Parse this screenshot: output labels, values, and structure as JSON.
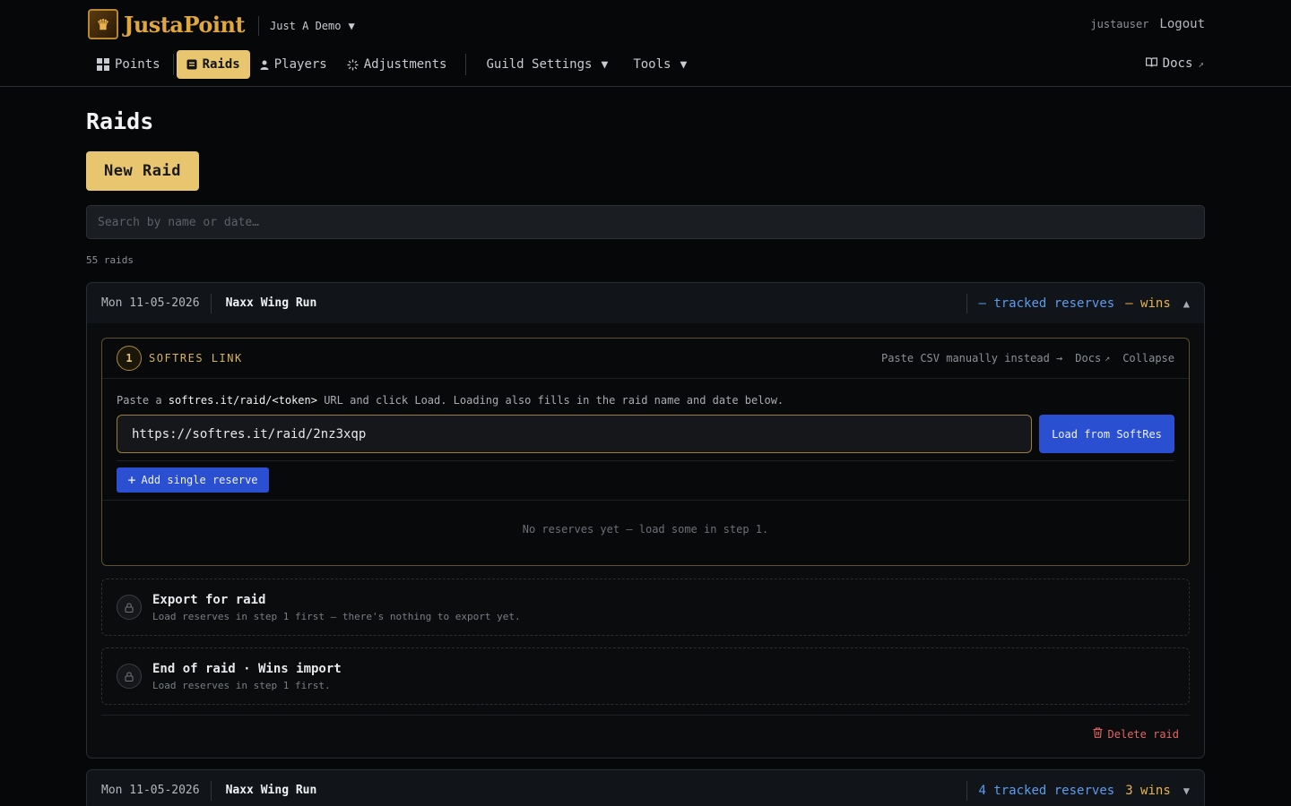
{
  "header": {
    "app_name": "JustaPoint",
    "logo_glyph": "♛",
    "guild": "Just A Demo",
    "username": "justauser",
    "logout": "Logout",
    "docs": "Docs"
  },
  "nav": {
    "items": [
      {
        "label": "Points",
        "icon": "grid-icon"
      },
      {
        "label": "Raids",
        "icon": "list-icon",
        "active": true
      },
      {
        "label": "Players",
        "icon": "person-icon"
      },
      {
        "label": "Adjustments",
        "icon": "sparkle-icon"
      },
      {
        "label": "Guild Settings",
        "icon": "",
        "dropdown": true
      },
      {
        "label": "Tools",
        "icon": "",
        "dropdown": true
      }
    ]
  },
  "main": {
    "title": "Raids",
    "new_raid": "New Raid",
    "search_placeholder": "Search by name or date…",
    "raid_count": "55 raids"
  },
  "raids": [
    {
      "date": "Mon 11-05-2026",
      "name": "Naxx Wing Run",
      "tracked": "— tracked reserves",
      "wins": "— wins",
      "expanded": true,
      "step1": {
        "number": "1",
        "title": "SOFTRES LINK",
        "link_csv": "Paste CSV manually instead →",
        "link_docs": "Docs",
        "link_collapse": "Collapse",
        "desc_pre": "Paste a ",
        "desc_code": "softres.it/raid/<token>",
        "desc_post": " URL and click Load. Loading also fills in the raid name and date below.",
        "url_value": "https://softres.it/raid/2nz3xqp",
        "load_button": "Load from SoftRes",
        "add_button": "Add single reserve",
        "empty": "No reserves yet — load some in step 1."
      },
      "export": {
        "title": "Export for raid",
        "subtitle": "Load reserves in step 1 first — there's nothing to export yet."
      },
      "end_of_raid": {
        "title": "End of raid · Wins import",
        "subtitle": "Load reserves in step 1 first."
      },
      "delete": "Delete raid"
    },
    {
      "date": "Mon 11-05-2026",
      "name": "Naxx Wing Run",
      "tracked": "4 tracked reserves",
      "wins": "3 wins",
      "expanded": false
    }
  ],
  "colors": {
    "accent": "#e8c56f",
    "primary_button": "#2a4fd0",
    "tracked": "#5b9cf0",
    "wins": "#e8b34a",
    "danger": "#e36363"
  }
}
